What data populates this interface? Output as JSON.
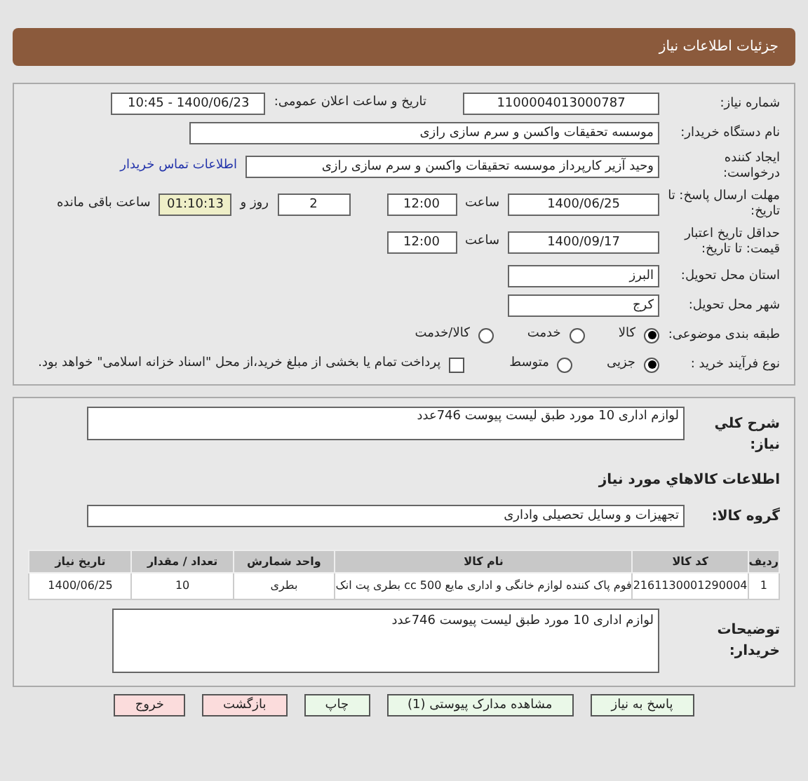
{
  "header": {
    "title": "جزئیات اطلاعات نیاز"
  },
  "need_number": {
    "label": "شماره نیاز:",
    "value": "1100004013000787"
  },
  "announce": {
    "label": "تاریخ و ساعت اعلان عمومی:",
    "value": "1400/06/23 - 10:45"
  },
  "buyer": {
    "label": "نام دستگاه خریدار:",
    "value": "موسسه تحقیقات واکسن و سرم سازی رازی"
  },
  "creator": {
    "label": "ایجاد کننده درخواست:",
    "value": "وحید آزیر کارپرداز موسسه تحقیقات واکسن و سرم سازی رازی",
    "link": "اطلاعات تماس خریدار"
  },
  "deadline": {
    "label": "مهلت ارسال پاسخ: تا تاریخ:",
    "date": "1400/06/25",
    "time_label": "ساعت",
    "time": "12:00",
    "days": "2",
    "days_label": "روز و",
    "remaining": "01:10:13",
    "remaining_label": "ساعت باقی مانده"
  },
  "validity": {
    "label": "حداقل تاریخ اعتبار قیمت: تا تاریخ:",
    "date": "1400/09/17",
    "time_label": "ساعت",
    "time": "12:00"
  },
  "province": {
    "label": "استان محل تحویل:",
    "value": "البرز"
  },
  "city": {
    "label": "شهر محل تحویل:",
    "value": "کرج"
  },
  "category": {
    "label": "طبقه بندی موضوعی:",
    "options": [
      {
        "label": "کالا",
        "selected": true
      },
      {
        "label": "خدمت",
        "selected": false
      },
      {
        "label": "کالا/خدمت",
        "selected": false
      }
    ]
  },
  "process": {
    "label": "نوع فرآیند خرید :",
    "options": [
      {
        "label": "جزیی",
        "selected": true
      },
      {
        "label": "متوسط",
        "selected": false
      }
    ],
    "payment": {
      "label": "پرداخت تمام یا بخشی از مبلغ خرید،از محل \"اسناد خزانه اسلامی\" خواهد بود.",
      "checked": false
    }
  },
  "summary": {
    "label": "شرح کلي نياز:",
    "value": "لوازم اداری 10 مورد  طبق لیست پیوست 746عدد"
  },
  "goods_heading": "اطلاعات کالاهاي مورد نياز",
  "group": {
    "label": "گروه کالا:",
    "value": "تجهیزات و وسایل تحصیلی واداری"
  },
  "table": {
    "columns": [
      "ردیف",
      "کد کالا",
      "نام کالا",
      "واحد شمارش",
      "تعداد / مقدار",
      "تاریخ نیاز"
    ],
    "rows": [
      [
        "1",
        "2161130001290004",
        "فوم پاک کننده لوازم خانگی و اداری مایع 500 cc بطری پت انک",
        "بطری",
        "10",
        "1400/06/25"
      ]
    ]
  },
  "notes": {
    "label": "توضیحات خریدار:",
    "value": "لوازم اداری 10 مورد  طبق لیست پیوست 746عدد"
  },
  "buttons": [
    {
      "label": "پاسخ به نیاز",
      "kind": "green"
    },
    {
      "label": "مشاهده مدارک پیوستی (1)",
      "kind": "green"
    },
    {
      "label": "چاپ",
      "kind": "green"
    },
    {
      "label": "بازگشت",
      "kind": "red"
    },
    {
      "label": "خروج",
      "kind": "red"
    }
  ]
}
